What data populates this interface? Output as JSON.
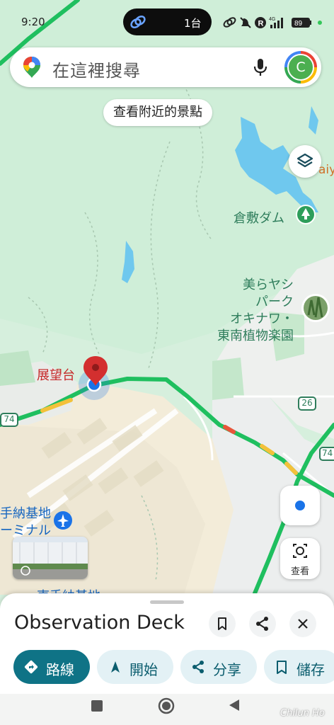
{
  "status": {
    "time": "9:20",
    "pill_text": "1台",
    "battery": "89",
    "network": "4G"
  },
  "search": {
    "placeholder": "在這裡搜尋",
    "avatar_letter": "C"
  },
  "chips": {
    "nearby": "查看附近的景點"
  },
  "map_labels": {
    "dam": "倉敷ダム",
    "cut_off_label": "aiy",
    "park_lines": [
      "美らヤシ",
      "パーク",
      "オキナワ・",
      "東南植物楽園"
    ],
    "pin": "展望台",
    "route_26": "26",
    "route_74_left": "74",
    "route_74_right": "74",
    "airbase_lines": [
      "手納基地",
      "ーミナル"
    ],
    "bottom_cut": "東手納基地"
  },
  "buttons": {
    "lens_label": "查看"
  },
  "place": {
    "name": "Observation Deck"
  },
  "actions": [
    {
      "label": "路線",
      "icon": "directions-icon",
      "primary": true
    },
    {
      "label": "開始",
      "icon": "navigation-arrow-icon",
      "primary": false
    },
    {
      "label": "分享",
      "icon": "share-icon",
      "primary": false
    },
    {
      "label": "儲存",
      "icon": "bookmark-icon",
      "primary": false
    }
  ],
  "watermark": "Chilun Ho",
  "colors": {
    "primary": "#0f7386",
    "pin": "#d32f2f",
    "road": "#1fbf5f",
    "water": "#6fc8ee",
    "location": "#1a73e8"
  }
}
